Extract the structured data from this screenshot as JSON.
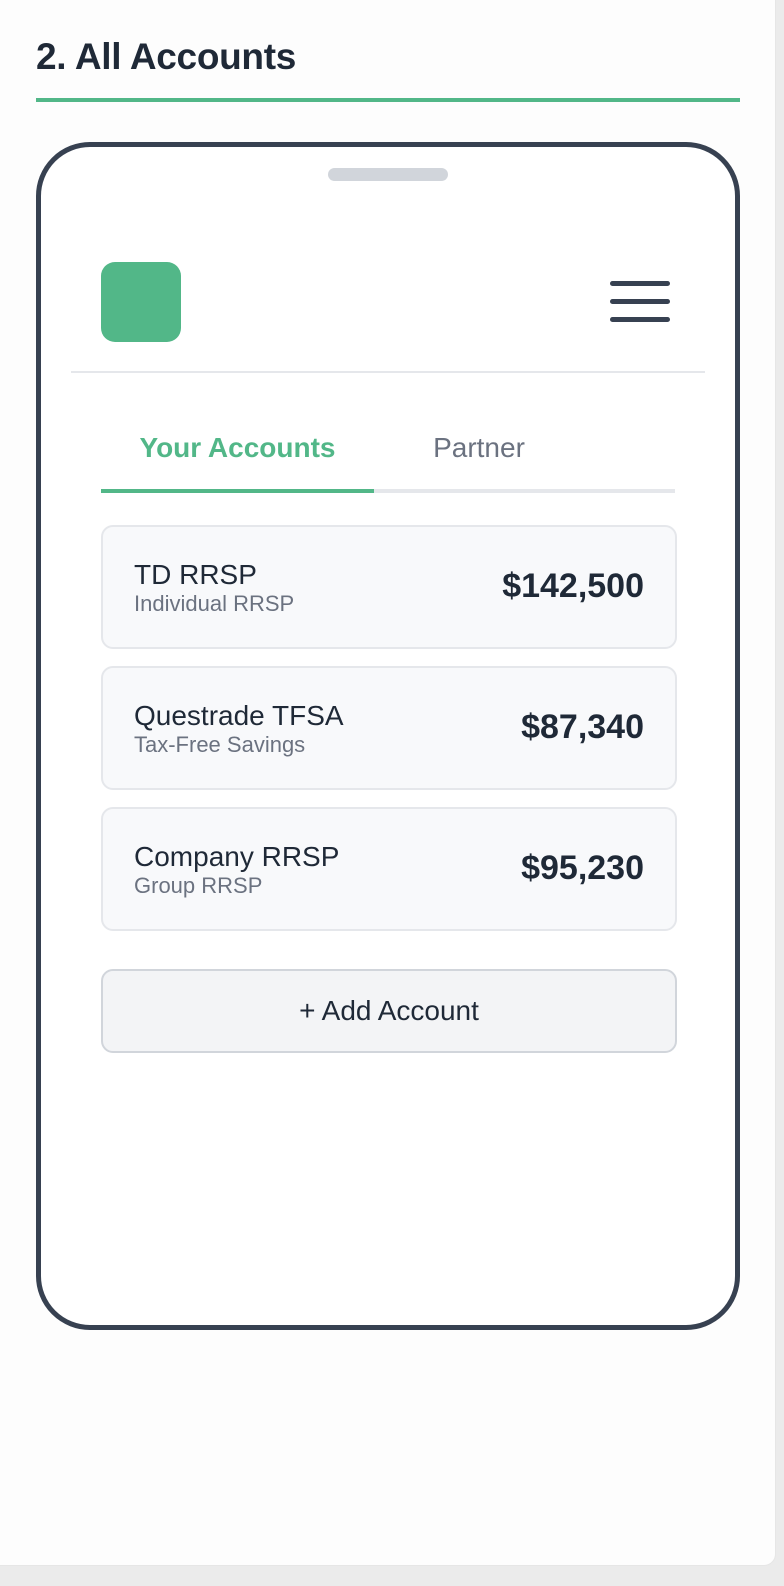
{
  "section": {
    "title": "2. All Accounts"
  },
  "header": {
    "logo_icon": "logo-square",
    "menu_icon": "hamburger-menu-icon"
  },
  "tabs": [
    {
      "label": "Your Accounts",
      "active": true
    },
    {
      "label": "Partner",
      "active": false
    }
  ],
  "accounts": [
    {
      "name": "TD RRSP",
      "type": "Individual RRSP",
      "amount": "$142,500"
    },
    {
      "name": "Questrade TFSA",
      "type": "Tax-Free Savings",
      "amount": "$87,340"
    },
    {
      "name": "Company RRSP",
      "type": "Group RRSP",
      "amount": "$95,230"
    }
  ],
  "add_account_label": "+ Add Account",
  "colors": {
    "accent": "#52b788",
    "text_primary": "#1f2937",
    "text_secondary": "#6b7280",
    "frame": "#374151"
  }
}
